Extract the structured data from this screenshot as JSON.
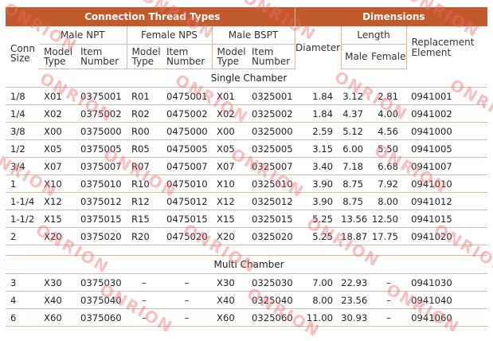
{
  "header": {
    "connection": "Connection Thread Types",
    "dimensions": "Dimensions"
  },
  "subheader": {
    "conn_size": "Conn Size",
    "male_npt": "Male NPT",
    "female_nps": "Female NPS",
    "male_bspt": "Male BSPT",
    "diameter": "Diameter",
    "length": "Length",
    "replacement": "Replacement Element",
    "model_type": "Model Type",
    "item_number": "Item Number",
    "male": "Male",
    "female": "Female"
  },
  "sections": {
    "single": "Single Chamber",
    "multi": "Multi Chamber"
  },
  "single_rows": [
    [
      "1/8",
      "X01",
      "0375001",
      "R01",
      "0475001",
      "X01",
      "0325001",
      "1.84",
      "3.12",
      "2.81",
      "0941001"
    ],
    [
      "1/4",
      "X02",
      "0375002",
      "R02",
      "0475002",
      "X02",
      "0325002",
      "1.84",
      "4.37",
      "4.00",
      "0941002"
    ],
    [
      "3/8",
      "X00",
      "0375000",
      "R00",
      "0475000",
      "X00",
      "0325000",
      "2.59",
      "5.12",
      "4.56",
      "0941000"
    ],
    [
      "1/2",
      "X05",
      "0375005",
      "R05",
      "0475005",
      "X05",
      "0325005",
      "3.15",
      "6.00",
      "5.50",
      "0941005"
    ],
    [
      "3/4",
      "X07",
      "0375007",
      "R07",
      "0475007",
      "X07",
      "0325007",
      "3.40",
      "7.18",
      "6.68",
      "0941007"
    ],
    [
      "1",
      "X10",
      "0375010",
      "R10",
      "0475010",
      "X10",
      "0325010",
      "3.90",
      "8.75",
      "7.92",
      "0941010"
    ],
    [
      "1-1/4",
      "X12",
      "0375012",
      "R12",
      "0475012",
      "X12",
      "0325012",
      "3.90",
      "8.75",
      "8.00",
      "0941012"
    ],
    [
      "1-1/2",
      "X15",
      "0375015",
      "R15",
      "0475015",
      "X15",
      "0325015",
      "5.25",
      "13.56",
      "12.50",
      "0941015"
    ],
    [
      "2",
      "X20",
      "0375020",
      "R20",
      "0475020",
      "X20",
      "0325020",
      "5.25",
      "18.87",
      "17.75",
      "0941020"
    ]
  ],
  "multi_rows": [
    [
      "3",
      "X30",
      "0375030",
      "–",
      "–",
      "X30",
      "0325030",
      "7.00",
      "22.93",
      "–",
      "0941030"
    ],
    [
      "4",
      "X40",
      "0375040",
      "–",
      "–",
      "X40",
      "0325040",
      "8.00",
      "23.56",
      "–",
      "0941040"
    ],
    [
      "6",
      "X60",
      "0375060",
      "–",
      "–",
      "X60",
      "0325060",
      "11.00",
      "30.93",
      "–",
      "0941060"
    ]
  ],
  "watermark": "ONRION",
  "colors": {
    "header_bg": "#c25a2b",
    "rule": "#d7b8a6",
    "watermark": "#ef6a6a"
  }
}
